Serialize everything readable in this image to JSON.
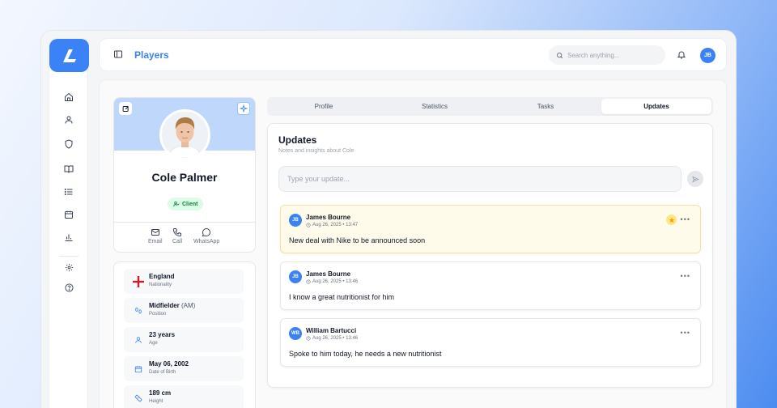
{
  "topbar": {
    "title": "Players",
    "search_placeholder": "Search anything...",
    "user_initials": "JB"
  },
  "sidebar": {
    "items": [
      {
        "icon": "home-icon"
      },
      {
        "icon": "user-icon"
      },
      {
        "icon": "shield-icon"
      },
      {
        "icon": "book-icon"
      },
      {
        "icon": "list-icon"
      },
      {
        "icon": "calendar-icon"
      },
      {
        "icon": "bar-chart-icon"
      },
      {
        "icon": "gear-icon"
      },
      {
        "icon": "help-icon"
      }
    ]
  },
  "profile": {
    "name": "Cole Palmer",
    "badge": "Client",
    "contacts": [
      {
        "label": "Email",
        "icon": "mail-icon"
      },
      {
        "label": "Call",
        "icon": "phone-icon"
      },
      {
        "label": "WhatsApp",
        "icon": "chat-bubble-icon"
      }
    ]
  },
  "info": [
    {
      "value": "England",
      "sub": "",
      "label": "Nationality",
      "icon": "england-flag-icon"
    },
    {
      "value": "Midfielder",
      "sub": "(AM)",
      "label": "Position",
      "icon": "footsteps-icon"
    },
    {
      "value": "23 years",
      "sub": "",
      "label": "Age",
      "icon": "user-icon"
    },
    {
      "value": "May 06, 2002",
      "sub": "",
      "label": "Date of Birth",
      "icon": "calendar-icon"
    },
    {
      "value": "189 cm",
      "sub": "",
      "label": "Height",
      "icon": "ruler-icon"
    }
  ],
  "tabs": [
    {
      "label": "Profile",
      "active": false
    },
    {
      "label": "Statistics",
      "active": false
    },
    {
      "label": "Tasks",
      "active": false
    },
    {
      "label": "Updates",
      "active": true
    }
  ],
  "updates": {
    "title": "Updates",
    "subtitle": "Notes and insights about Cole",
    "input_placeholder": "Type your update...",
    "notes": [
      {
        "initials": "JB",
        "author": "James Bourne",
        "time": "Aug 26, 2025 • 13:47",
        "text": "New deal with Nike to be announced soon",
        "pinned": true
      },
      {
        "initials": "JB",
        "author": "James Bourne",
        "time": "Aug 26, 2025 • 13:46",
        "text": "I know a great nutritionist for him",
        "pinned": false
      },
      {
        "initials": "WB",
        "author": "William Bartucci",
        "time": "Aug 26, 2025 • 13:46",
        "text": "Spoke to him today, he needs a new nutritionist",
        "pinned": false
      }
    ]
  },
  "colors": {
    "accent": "#3b82f6",
    "badge_bg": "#dcfce7",
    "badge_text": "#15803d",
    "pinned_bg": "#fefbea"
  }
}
